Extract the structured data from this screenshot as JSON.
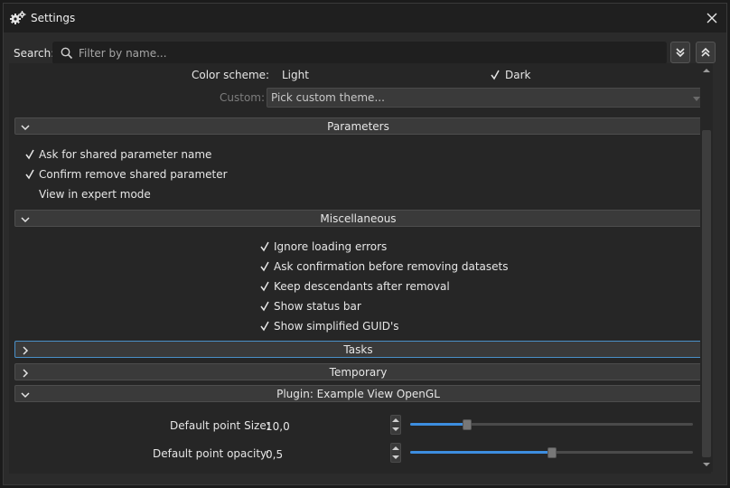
{
  "window": {
    "title": "Settings"
  },
  "search": {
    "label": "Search:",
    "placeholder": "Filter by name..."
  },
  "appearance": {
    "color_scheme_label": "Color scheme:",
    "option_light": "Light",
    "option_dark": "Dark",
    "selected": "Dark",
    "custom_label": "Custom:",
    "custom_value": "Pick custom theme..."
  },
  "sections": {
    "parameters": {
      "title": "Parameters",
      "items": [
        {
          "label": "Ask for shared parameter name",
          "checked": true
        },
        {
          "label": "Confirm remove shared parameter",
          "checked": true
        },
        {
          "label": "View in expert mode",
          "checked": false
        }
      ]
    },
    "misc": {
      "title": "Miscellaneous",
      "items": [
        {
          "label": "Ignore loading errors",
          "checked": true
        },
        {
          "label": "Ask confirmation before removing datasets",
          "checked": true
        },
        {
          "label": "Keep descendants after removal",
          "checked": true
        },
        {
          "label": "Show status bar",
          "checked": true
        },
        {
          "label": "Show simplified GUID's",
          "checked": true
        }
      ]
    },
    "tasks": {
      "title": "Tasks"
    },
    "temporary": {
      "title": "Temporary"
    },
    "plugin": {
      "title": "Plugin: Example View OpenGL",
      "point_size": {
        "label": "Default point Size:",
        "value": "10,0",
        "slider_fraction": 0.19
      },
      "point_opacity": {
        "label": "Default point opacity:",
        "value": "0,5",
        "slider_fraction": 0.5
      }
    }
  },
  "colors": {
    "accent": "#3d8ee0",
    "focus": "#4a90c8",
    "background": "#262626",
    "header": "#3a3a3a"
  }
}
